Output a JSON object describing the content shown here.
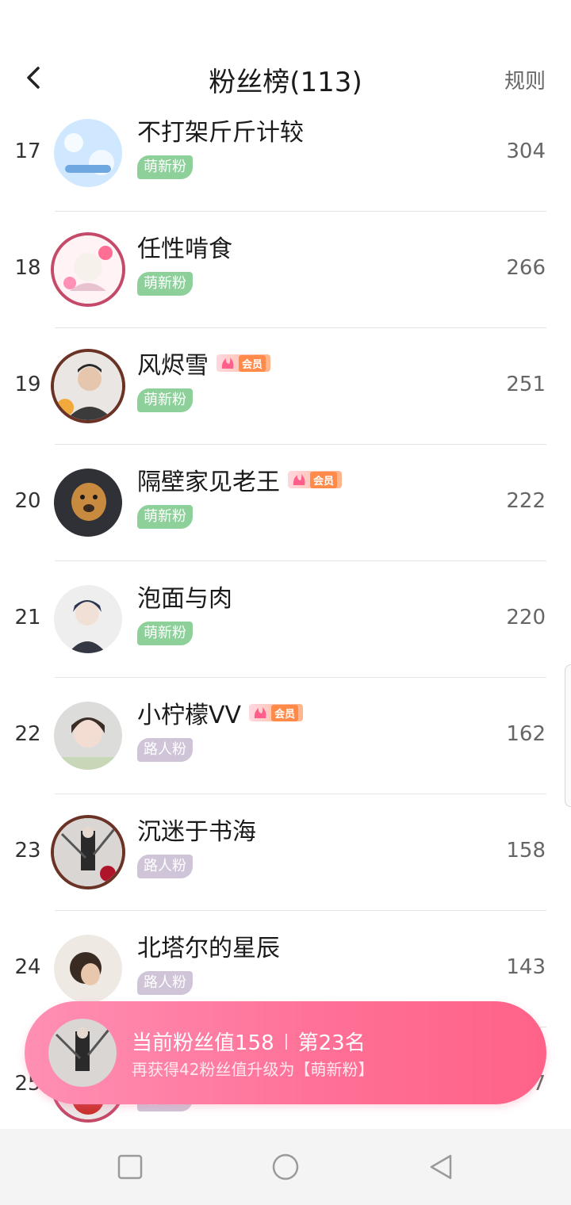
{
  "header": {
    "title": "粉丝榜(113)",
    "rules": "规则"
  },
  "rows": [
    {
      "rank": "17",
      "name": "不打架斤斤计较",
      "badge": "萌新粉",
      "badge_color": "green",
      "score": "304",
      "vip": false,
      "vip_label": ""
    },
    {
      "rank": "18",
      "name": "任性啃食",
      "badge": "萌新粉",
      "badge_color": "green",
      "score": "266",
      "vip": false,
      "vip_label": ""
    },
    {
      "rank": "19",
      "name": "风烬雪",
      "badge": "萌新粉",
      "badge_color": "green",
      "score": "251",
      "vip": true,
      "vip_label": "会员"
    },
    {
      "rank": "20",
      "name": "隔壁家见老王",
      "badge": "萌新粉",
      "badge_color": "green",
      "score": "222",
      "vip": true,
      "vip_label": "会员"
    },
    {
      "rank": "21",
      "name": "泡面与肉",
      "badge": "萌新粉",
      "badge_color": "green",
      "score": "220",
      "vip": false,
      "vip_label": ""
    },
    {
      "rank": "22",
      "name": "小柠檬VV",
      "badge": "路人粉",
      "badge_color": "gray",
      "score": "162",
      "vip": true,
      "vip_label": "会员"
    },
    {
      "rank": "23",
      "name": "沉迷于书海",
      "badge": "路人粉",
      "badge_color": "gray",
      "score": "158",
      "vip": false,
      "vip_label": ""
    },
    {
      "rank": "24",
      "name": "北塔尔的星辰",
      "badge": "路人粉",
      "badge_color": "gray",
      "score": "143",
      "vip": false,
      "vip_label": ""
    },
    {
      "rank": "25",
      "name": "",
      "badge": "路人粉",
      "badge_color": "gray",
      "score": "7",
      "vip": false,
      "vip_label": ""
    }
  ],
  "current": {
    "value_text": "当前粉丝值158",
    "rank_text": "第23名",
    "upgrade_text": "再获得42粉丝值升级为【萌新粉】"
  },
  "colors": {
    "badge_green": "#8dd09a",
    "badge_gray": "#cfc4d8",
    "bar_start": "#ff8fb4",
    "bar_end": "#ff6288"
  },
  "icons": {
    "back": "chevron-left-icon",
    "vip": "vip-flame-icon",
    "nav": [
      "square-icon",
      "circle-icon",
      "triangle-back-icon"
    ]
  }
}
